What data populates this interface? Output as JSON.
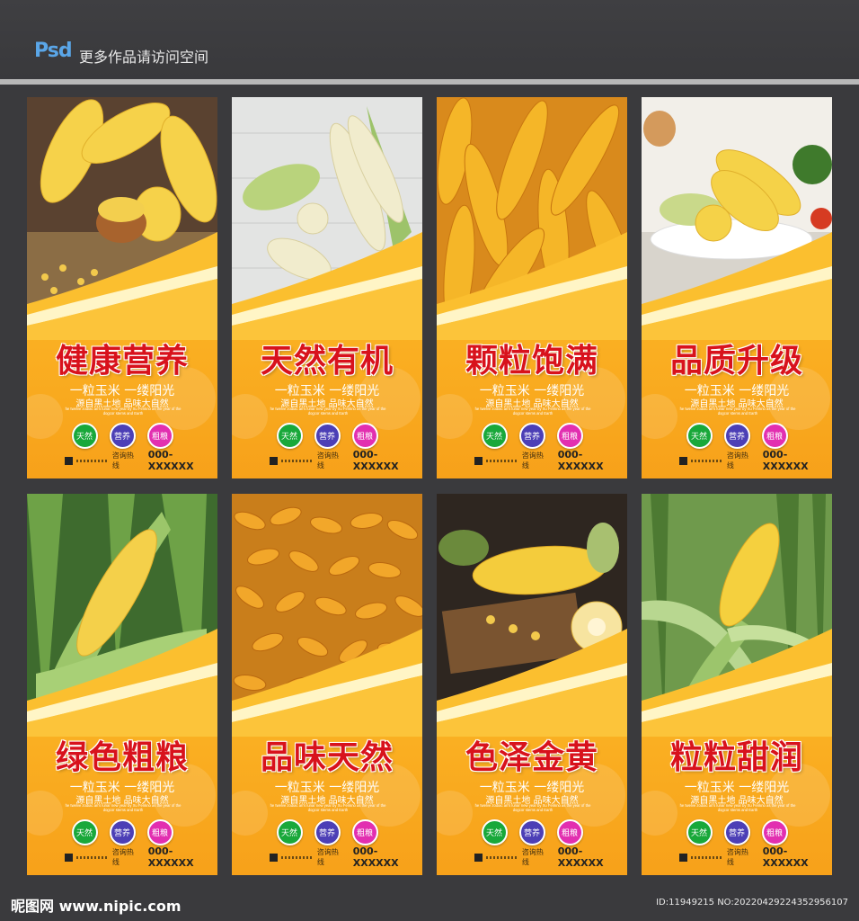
{
  "header": {
    "psd_label": "Psd",
    "tagline": "更多作品请访问空间"
  },
  "cards": [
    {
      "title": "健康营养",
      "scene": "corn-cobs-with-kernel-bowl"
    },
    {
      "title": "天然有机",
      "scene": "white-corn-on-table"
    },
    {
      "title": "颗粒饱满",
      "scene": "pile-of-yellow-corn-cobs"
    },
    {
      "title": "品质升级",
      "scene": "corn-on-plate-with-vegetables"
    },
    {
      "title": "绿色粗粮",
      "scene": "corn-on-stalk-in-field"
    },
    {
      "title": "品味天然",
      "scene": "pile-of-dried-corn"
    },
    {
      "title": "色泽金黄",
      "scene": "corn-on-wooden-board"
    },
    {
      "title": "粒粒甜润",
      "scene": "corn-in-green-field"
    }
  ],
  "card_common": {
    "slogan": "一粒玉米 一缕阳光",
    "sub": "源自黑土地 品味大自然",
    "tiny_text": "he twelve zodiac an's lunar new year by Xu Fenkno as the year of the dogcor stems and Earth",
    "badges": [
      "天然",
      "营养",
      "粗粮"
    ],
    "contact_label": "咨询热线",
    "contact_number": "000-XXXXXX"
  },
  "footer": {
    "logo": "昵图网 www.nipic.com",
    "id_line": "ID:11949215 NO:20220429224352956107"
  }
}
